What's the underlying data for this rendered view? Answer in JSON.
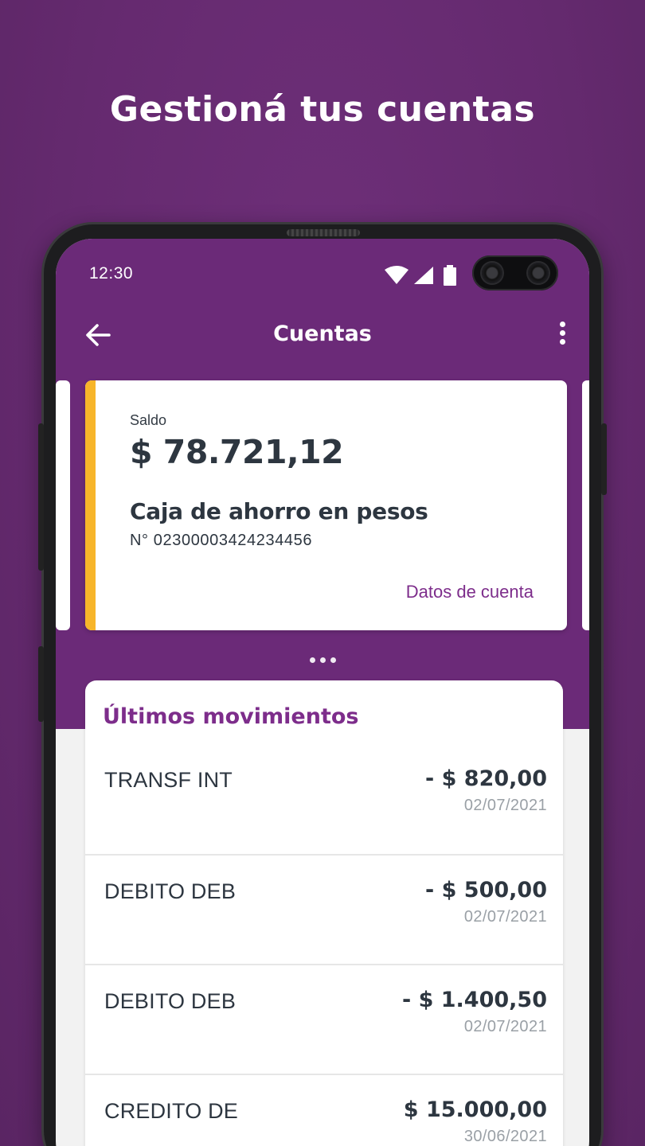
{
  "headline": "Gestioná tus cuentas",
  "status_bar": {
    "time": "12:30",
    "icons": [
      "wifi-icon",
      "signal-icon",
      "battery-icon"
    ]
  },
  "app_bar": {
    "title": "Cuentas",
    "back_icon": "arrow-left-icon",
    "menu_icon": "more-vertical-icon"
  },
  "account_card": {
    "balance_label": "Saldo",
    "balance": "$ 78.721,12",
    "account_type": "Caja de ahorro en pesos",
    "account_number": "N° 02300003424234456",
    "details_link": "Datos de cuenta",
    "accent_color": "#f7b52a"
  },
  "movements": {
    "title": "Últimos movimientos",
    "items": [
      {
        "description": "TRANSF INT",
        "amount": "- $ 820,00",
        "date": "02/07/2021"
      },
      {
        "description": "DEBITO DEB",
        "amount": "- $ 500,00",
        "date": "02/07/2021"
      },
      {
        "description": "DEBITO DEB",
        "amount": "- $ 1.400,50",
        "date": "02/07/2021"
      },
      {
        "description": "CREDITO DE",
        "amount": "$ 15.000,00",
        "date": "30/06/2021"
      }
    ]
  },
  "colors": {
    "brand_purple": "#6b2a78",
    "link_purple": "#7d2d8b",
    "background": "#662a70"
  }
}
